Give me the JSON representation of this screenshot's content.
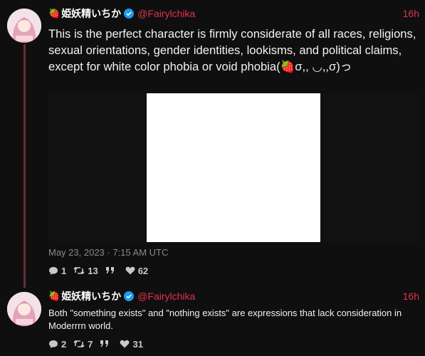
{
  "tweets": [
    {
      "display_name": "姫妖精いちか",
      "handle": "@Fairylchika",
      "time": "16h",
      "text": "This is the perfect character is firmly considerate of all races, religions, sexual orientations, gender identities, lookisms, and political claims, except for white color phobia or void phobia(🍓σ,, ◡,,σ)っ",
      "date": "May 23, 2023 · 7:15 AM UTC",
      "stats": {
        "replies": "1",
        "retweets": "13",
        "quotes": "",
        "likes": "62"
      }
    },
    {
      "display_name": "姫妖精いちか",
      "handle": "@Fairylchika",
      "time": "16h",
      "text": "Both \"something exists\" and \"nothing exists\" are expressions that lack consideration in Moderrrn world.",
      "stats": {
        "replies": "2",
        "retweets": "7",
        "quotes": "",
        "likes": "31"
      }
    }
  ],
  "colors": {
    "accent": "#e0334a",
    "background": "#0f0f0f",
    "thread_line": "#6e2b34",
    "verified": "#1d9bf0"
  }
}
